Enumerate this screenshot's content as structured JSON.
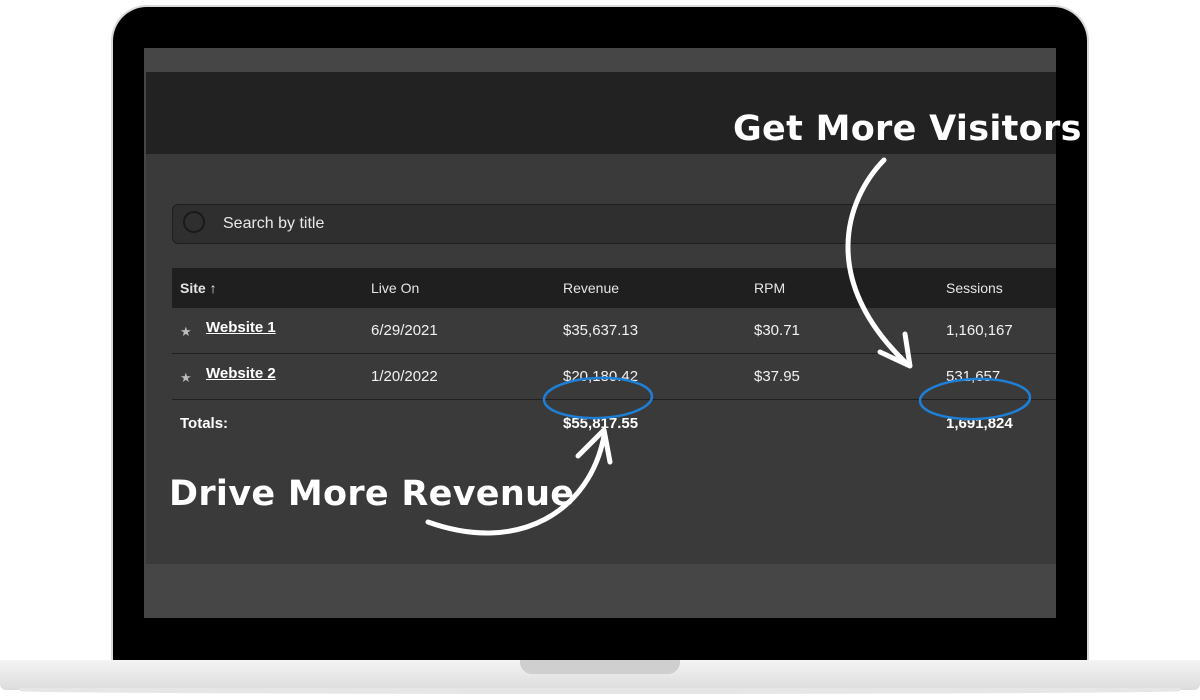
{
  "search": {
    "placeholder": "Search by title"
  },
  "table": {
    "headers": {
      "site": "Site",
      "sort_arrow": "↑",
      "live_on": "Live On",
      "revenue": "Revenue",
      "rpm": "RPM",
      "sessions": "Sessions"
    },
    "rows": [
      {
        "site": "Website 1",
        "live_on": "6/29/2021",
        "revenue": "$35,637.13",
        "rpm": "$30.71",
        "sessions": "1,160,167"
      },
      {
        "site": "Website 2",
        "live_on": "1/20/2022",
        "revenue": "$20,180.42",
        "rpm": "$37.95",
        "sessions": "531,657"
      }
    ],
    "totals": {
      "label": "Totals:",
      "revenue": "$55,817.55",
      "sessions": "1,691,824"
    }
  },
  "annotations": {
    "visitors": "Get More Visitors",
    "revenue": "Drive More Revenue",
    "circle_color": "#1e7fd6"
  }
}
